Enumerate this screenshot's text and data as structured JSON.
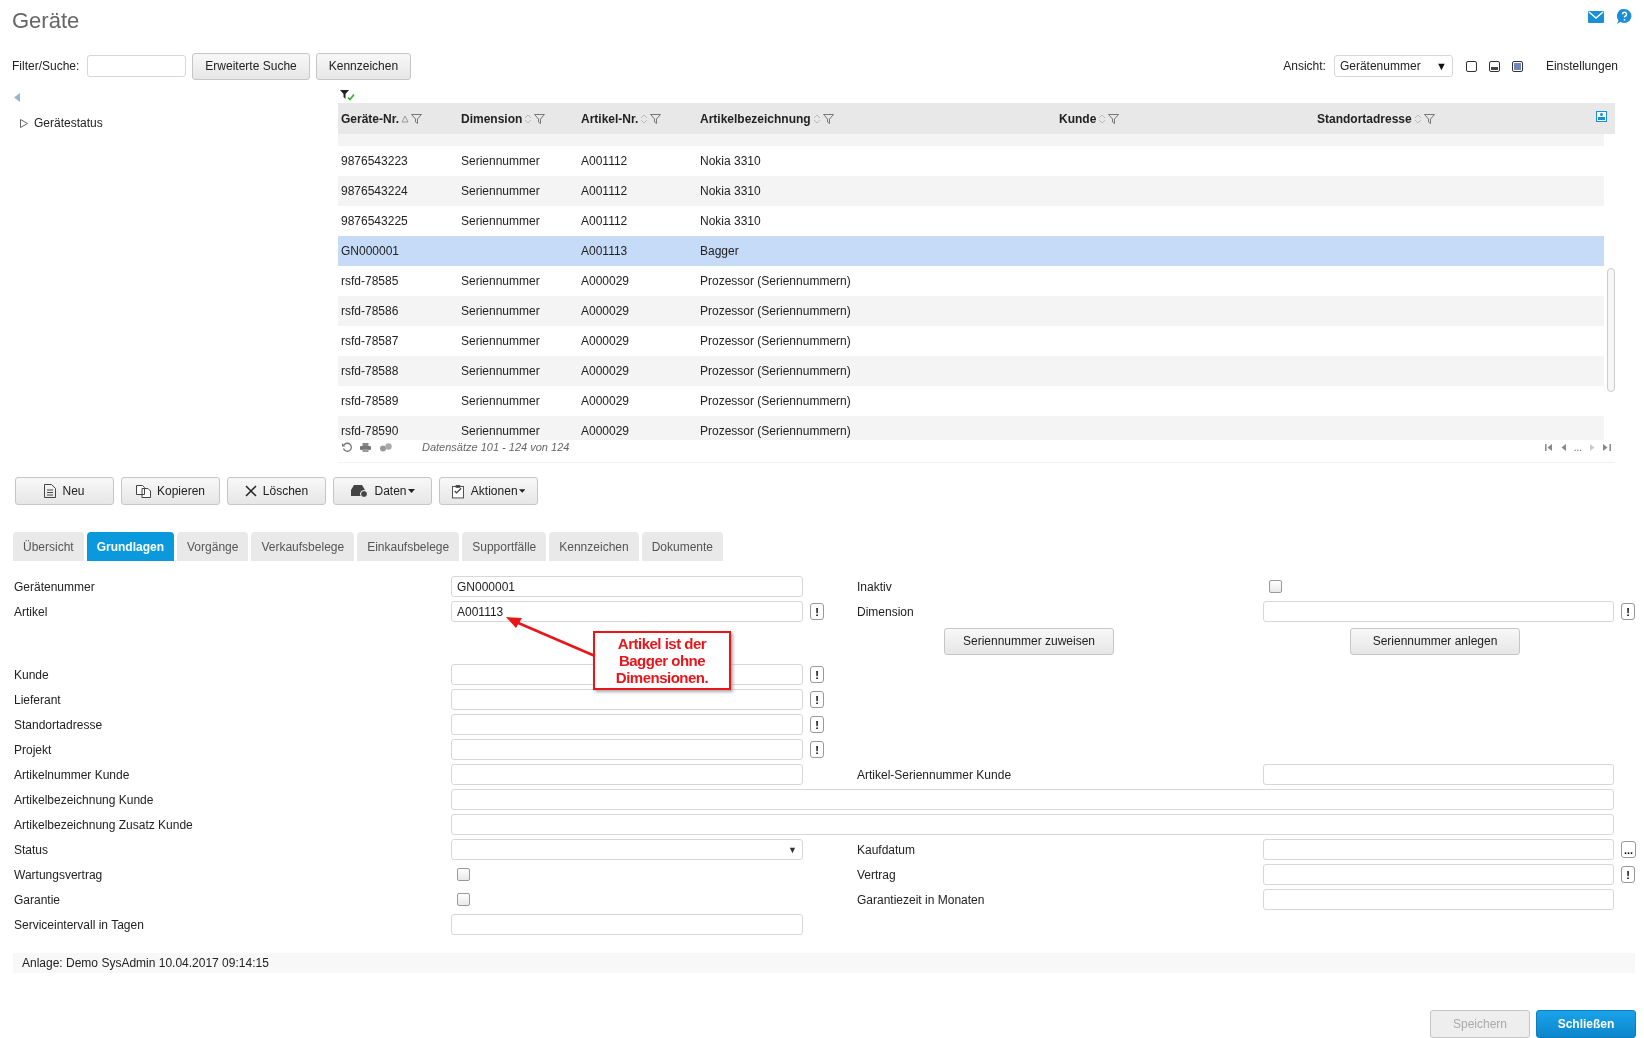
{
  "page_title": "Geräte",
  "filter": {
    "label": "Filter/Suche:"
  },
  "toolbar_buttons": [
    "Erweiterte Suche",
    "Kennzeichen"
  ],
  "view": {
    "label": "Ansicht:",
    "value": "Gerätenummer",
    "caret": "▼",
    "modes": [
      {
        "selected": false
      },
      {
        "selected": false
      },
      {
        "selected": true
      }
    ],
    "settings": "Einstellungen"
  },
  "tree": [
    {
      "label": "Gerätestatus",
      "expanded": false
    }
  ],
  "table": {
    "columns": [
      {
        "label": "Geräte-Nr.",
        "sorted": true
      },
      {
        "label": "Dimension",
        "sorted": false
      },
      {
        "label": "Artikel-Nr.",
        "sorted": false
      },
      {
        "label": "Artikelbezeichnung",
        "sorted": false
      },
      {
        "label": "Kunde",
        "sorted": false
      },
      {
        "label": "Standortadresse",
        "sorted": false
      }
    ],
    "rows": [
      {
        "cells": [
          "9876543223",
          "Seriennummer",
          "A001112",
          "Nokia 3310",
          "",
          ""
        ],
        "selected": false
      },
      {
        "cells": [
          "9876543224",
          "Seriennummer",
          "A001112",
          "Nokia 3310",
          "",
          ""
        ],
        "selected": false
      },
      {
        "cells": [
          "9876543225",
          "Seriennummer",
          "A001112",
          "Nokia 3310",
          "",
          ""
        ],
        "selected": false
      },
      {
        "cells": [
          "GN000001",
          "",
          "A001113",
          "Bagger",
          "",
          ""
        ],
        "selected": true
      },
      {
        "cells": [
          "rsfd-78585",
          "Seriennummer",
          "A000029",
          "Prozessor (Seriennummern)",
          "",
          ""
        ],
        "selected": false
      },
      {
        "cells": [
          "rsfd-78586",
          "Seriennummer",
          "A000029",
          "Prozessor (Seriennummern)",
          "",
          ""
        ],
        "selected": false
      },
      {
        "cells": [
          "rsfd-78587",
          "Seriennummer",
          "A000029",
          "Prozessor (Seriennummern)",
          "",
          ""
        ],
        "selected": false
      },
      {
        "cells": [
          "rsfd-78588",
          "Seriennummer",
          "A000029",
          "Prozessor (Seriennummern)",
          "",
          ""
        ],
        "selected": false
      },
      {
        "cells": [
          "rsfd-78589",
          "Seriennummer",
          "A000029",
          "Prozessor (Seriennummern)",
          "",
          ""
        ],
        "selected": false
      },
      {
        "cells": [
          "rsfd-78590",
          "Seriennummer",
          "A000029",
          "Prozessor (Seriennummern)",
          "",
          ""
        ],
        "selected": false
      }
    ]
  },
  "pager": {
    "info": "Datensätze 101 - 124 von 124",
    "ellipsis": "..."
  },
  "actions": [
    {
      "label": "Neu",
      "menu": false
    },
    {
      "label": "Kopieren",
      "menu": false
    },
    {
      "label": "Löschen",
      "menu": false
    },
    {
      "label": "Daten",
      "menu": true
    },
    {
      "label": "Aktionen",
      "menu": true
    }
  ],
  "tabs": [
    {
      "label": "Übersicht",
      "selected": false
    },
    {
      "label": "Grundlagen",
      "selected": true
    },
    {
      "label": "Vorgänge",
      "selected": false
    },
    {
      "label": "Verkaufsbelege",
      "selected": false
    },
    {
      "label": "Einkaufsbelege",
      "selected": false
    },
    {
      "label": "Supportfälle",
      "selected": false
    },
    {
      "label": "Kennzeichen",
      "selected": false
    },
    {
      "label": "Dokumente",
      "selected": false
    }
  ],
  "form": {
    "rows": [
      {
        "left": {
          "label": "Gerätenummer",
          "kind": "text",
          "value": "GN000001"
        },
        "right": {
          "label": "Inaktiv",
          "kind": "checkbox",
          "checked": false
        }
      },
      {
        "left": {
          "label": "Artikel",
          "kind": "text",
          "value": "A001113",
          "button": "!"
        },
        "right": {
          "label": "Dimension",
          "kind": "text",
          "button": "!"
        }
      },
      {
        "kind": "buttons",
        "buttons": [
          "Seriennummer zuweisen",
          "Seriennummer anlegen"
        ]
      },
      {
        "left": {
          "label": "Kunde",
          "kind": "text",
          "button": "!"
        }
      },
      {
        "left": {
          "label": "Lieferant",
          "kind": "text",
          "button": "!"
        }
      },
      {
        "left": {
          "label": "Standortadresse",
          "kind": "text",
          "button": "!"
        }
      },
      {
        "left": {
          "label": "Projekt",
          "kind": "text",
          "button": "!"
        }
      },
      {
        "left": {
          "label": "Artikelnummer Kunde",
          "kind": "text"
        },
        "right": {
          "label": "Artikel-Seriennummer Kunde",
          "kind": "text"
        }
      },
      {
        "left": {
          "label": "Artikelbezeichnung Kunde",
          "kind": "wide"
        }
      },
      {
        "left": {
          "label": "Artikelbezeichnung Zusatz Kunde",
          "kind": "wide"
        }
      },
      {
        "left": {
          "label": "Status",
          "kind": "select",
          "caret": "▼"
        },
        "right": {
          "label": "Kaufdatum",
          "kind": "text",
          "button": "..."
        }
      },
      {
        "left": {
          "label": "Wartungsvertrag",
          "kind": "checkbox",
          "checked": false
        },
        "right": {
          "label": "Vertrag",
          "kind": "text",
          "button": "!"
        }
      },
      {
        "left": {
          "label": "Garantie",
          "kind": "checkbox",
          "checked": false
        },
        "right": {
          "label": "Garantiezeit in Monaten",
          "kind": "text"
        }
      },
      {
        "left": {
          "label": "Serviceintervall in Tagen",
          "kind": "text"
        }
      }
    ]
  },
  "footer": "Anlage: Demo SysAdmin 10.04.2017 09:14:15",
  "buttons": [
    {
      "label": "Speichern",
      "disabled": true,
      "primary": false
    },
    {
      "label": "Schließen",
      "disabled": false,
      "primary": true
    }
  ],
  "annotation": {
    "text": "Artikel ist der Bagger ohne Dimensionen."
  }
}
